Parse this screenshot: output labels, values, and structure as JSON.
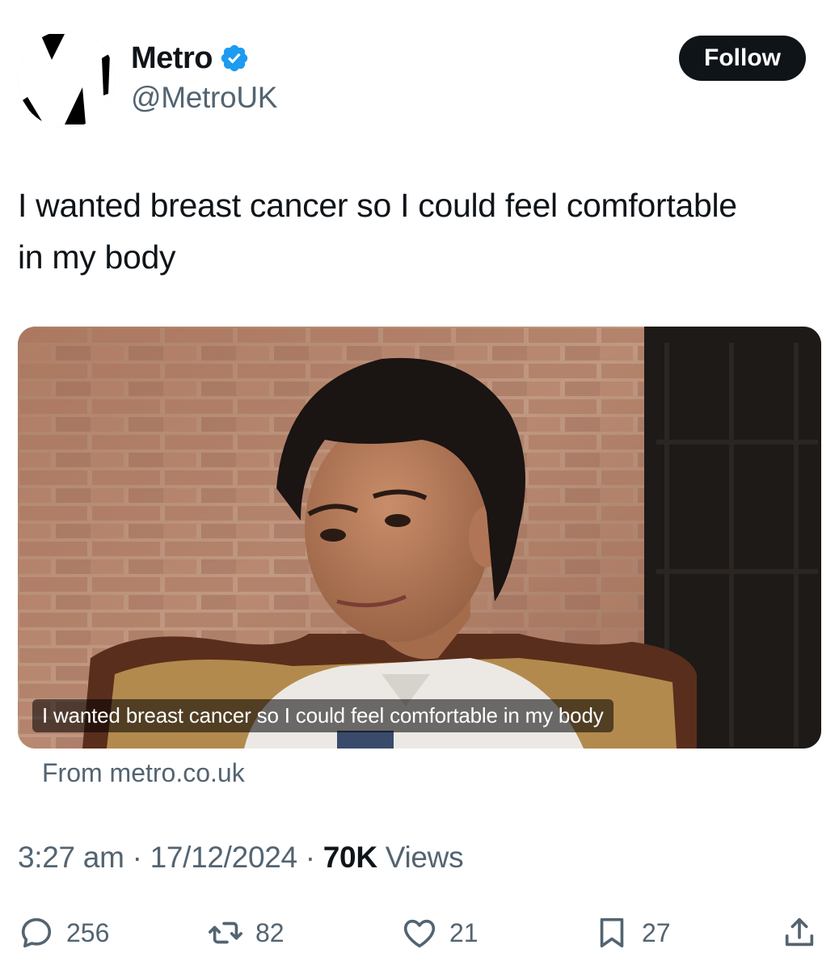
{
  "author": {
    "name": "Metro",
    "handle": "@MetroUK",
    "verified_color": "#1d9bf0"
  },
  "follow_button": {
    "label": "Follow"
  },
  "tweet": {
    "text": "I wanted breast cancer so I could feel comfortable in my body"
  },
  "media": {
    "caption": "I wanted breast cancer so I could feel comfortable in my body",
    "source": "From metro.co.uk"
  },
  "meta": {
    "time": "3:27 am",
    "separator": "·",
    "date": "17/12/2024",
    "views_count": "70K",
    "views_label": "Views"
  },
  "actions": {
    "replies": "256",
    "reposts": "82",
    "likes": "21",
    "bookmarks": "27",
    "icons": [
      "reply-icon",
      "repost-icon",
      "like-icon",
      "bookmark-icon",
      "share-icon"
    ]
  }
}
